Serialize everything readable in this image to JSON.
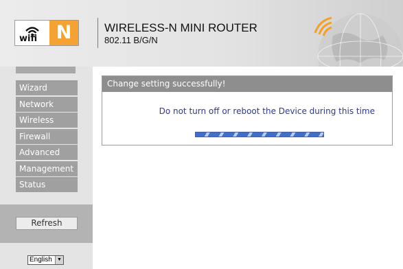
{
  "header": {
    "logo_wifi_text": "wifi",
    "logo_letter": "N",
    "title": "WIRELESS-N MINI ROUTER",
    "subtitle": "802.11 B/G/N"
  },
  "sidebar": {
    "menu_items": [
      {
        "label": "Wizard"
      },
      {
        "label": "Network"
      },
      {
        "label": "Wireless"
      },
      {
        "label": "Firewall"
      },
      {
        "label": "Advanced"
      },
      {
        "label": "Management"
      },
      {
        "label": "Status"
      }
    ],
    "refresh_label": "Refresh",
    "language": {
      "selected": "English"
    }
  },
  "content": {
    "panel_title": "Change setting successfully!",
    "message": "Do not turn off or reboot the Device during this time",
    "progress_percent": 100
  },
  "colors": {
    "accent_orange": "#f4a233",
    "menu_bg": "#a0a0a0",
    "message_text": "#2b3a8f",
    "progress_blue": "#3f6fc8"
  },
  "icons": {
    "logo": "wifi-signal-icon",
    "header_art": "globe-icon",
    "dropdown": "chevron-down-icon"
  }
}
